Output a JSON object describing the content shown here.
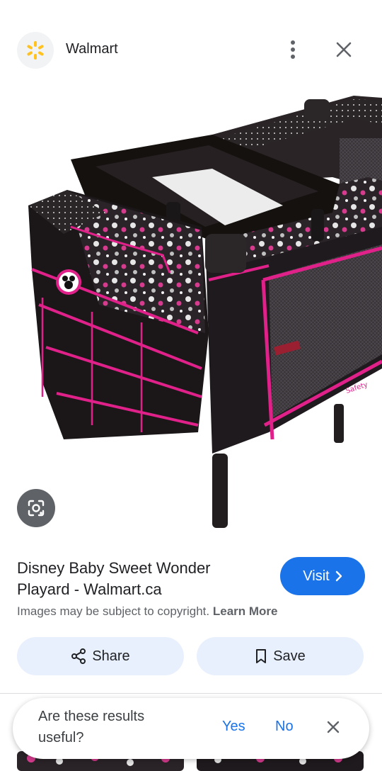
{
  "header": {
    "site_name": "Walmart",
    "logo_icon": "walmart-spark-icon",
    "brand_color": "#ffc220"
  },
  "image": {
    "description_icon": "playard-image"
  },
  "result": {
    "title": "Disney Baby Sweet Wonder Playard - Walmart.ca",
    "visit_label": "Visit",
    "copyright_text": "Images may be subject to copyright.",
    "learn_more_label": "Learn More"
  },
  "actions": {
    "share_label": "Share",
    "save_label": "Save"
  },
  "feedback": {
    "question": "Are these results useful?",
    "yes_label": "Yes",
    "no_label": "No"
  },
  "colors": {
    "accent": "#1a73e8",
    "chip_background": "#e8f0fe",
    "playard_pink": "#e0218a",
    "playard_black": "#1f1a1d"
  }
}
